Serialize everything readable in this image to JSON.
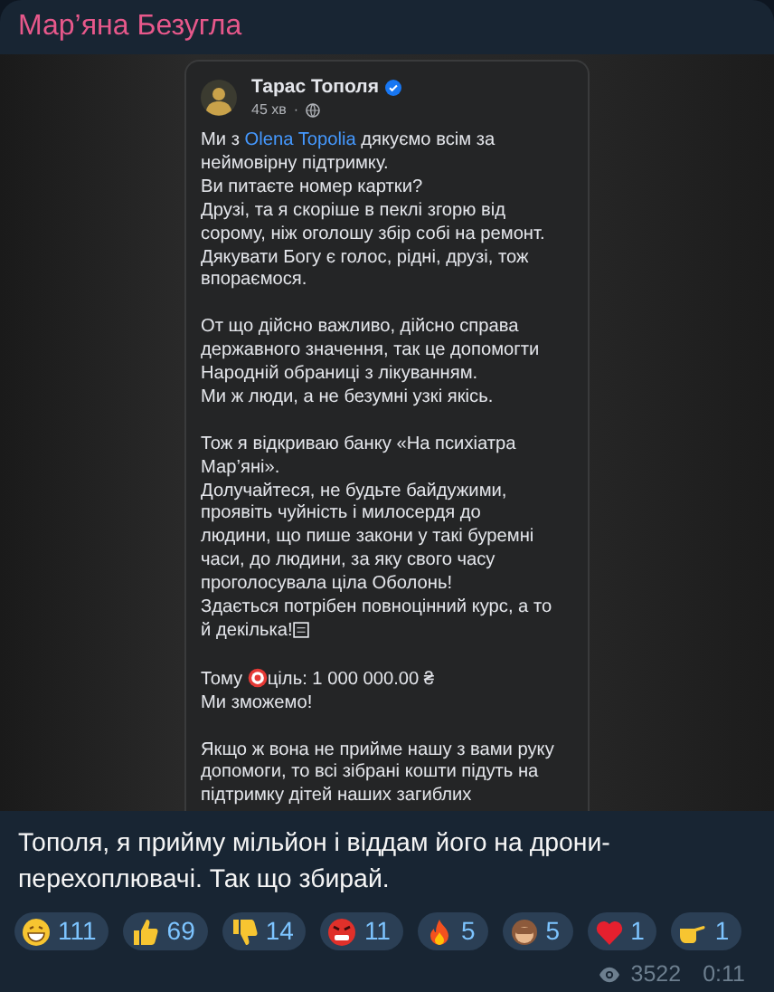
{
  "sender": "Мар’яна Безугла",
  "post": {
    "author": "Тарас Тополя",
    "verified": true,
    "time": "45 хв",
    "time_separator": "·",
    "paragraphs": [
      {
        "lines": [
          [
            {
              "text": "Ми з "
            },
            {
              "text": "Olena Topolia",
              "kind": "link"
            },
            {
              "text": " дякуємо всім за"
            }
          ],
          "неймовірну підтримку.",
          "Ви питаєте номер картки?",
          "Друзі, та я скоріше в пеклі згорю від",
          "сорому, ніж оголошу збір собі на ремонт.",
          "Дякувати Богу є голос, рідні, друзі, тож",
          "впораємося."
        ]
      },
      {
        "lines": [
          "От що дійсно важливо, дійсно справа",
          "державного значення, так це допомогти",
          "Народній обраниці з лікуванням.",
          "Ми ж люди, а не безумні узкі якісь."
        ]
      },
      {
        "lines": [
          "Тож я відкриваю банку «На психіатра",
          "Мар’яні».",
          "Долучайтеся, не будьте байдужими,",
          "проявіть чуйність і милосердя до",
          "людини, що пише закони у такі буремні",
          "часи, до людини, за яку свого часу",
          "проголосувала ціла Оболонь!",
          "Здається потрібен повноцінний курс, а то",
          [
            {
              "text": "й декілька!"
            },
            {
              "kind": "glyph-box"
            }
          ]
        ]
      },
      {
        "lines": [
          [
            {
              "text": "Тому "
            },
            {
              "kind": "target"
            },
            {
              "text": "ціль: 1 000 000.00 ₴"
            }
          ],
          "Ми  зможемо!"
        ]
      },
      {
        "lines": [
          "Якщо ж вона не прийме нашу з вами руку",
          "допомоги, то всі зібрані кошти підуть на",
          "підтримку дітей наших загиблих"
        ]
      }
    ]
  },
  "message": "Тополя, я прийму мільйон і віддам його на дрони-перехоплювачі. Так що збирай.",
  "reactions": [
    {
      "kind": "grin",
      "count": "111"
    },
    {
      "kind": "thumbs-up",
      "count": "69"
    },
    {
      "kind": "thumbs-down",
      "count": "14"
    },
    {
      "kind": "angry",
      "count": "11"
    },
    {
      "kind": "fire",
      "count": "5"
    },
    {
      "kind": "monkey",
      "count": "5"
    },
    {
      "kind": "heart",
      "count": "1"
    },
    {
      "kind": "point",
      "count": "1"
    }
  ],
  "views": "3522",
  "time": "0:11"
}
